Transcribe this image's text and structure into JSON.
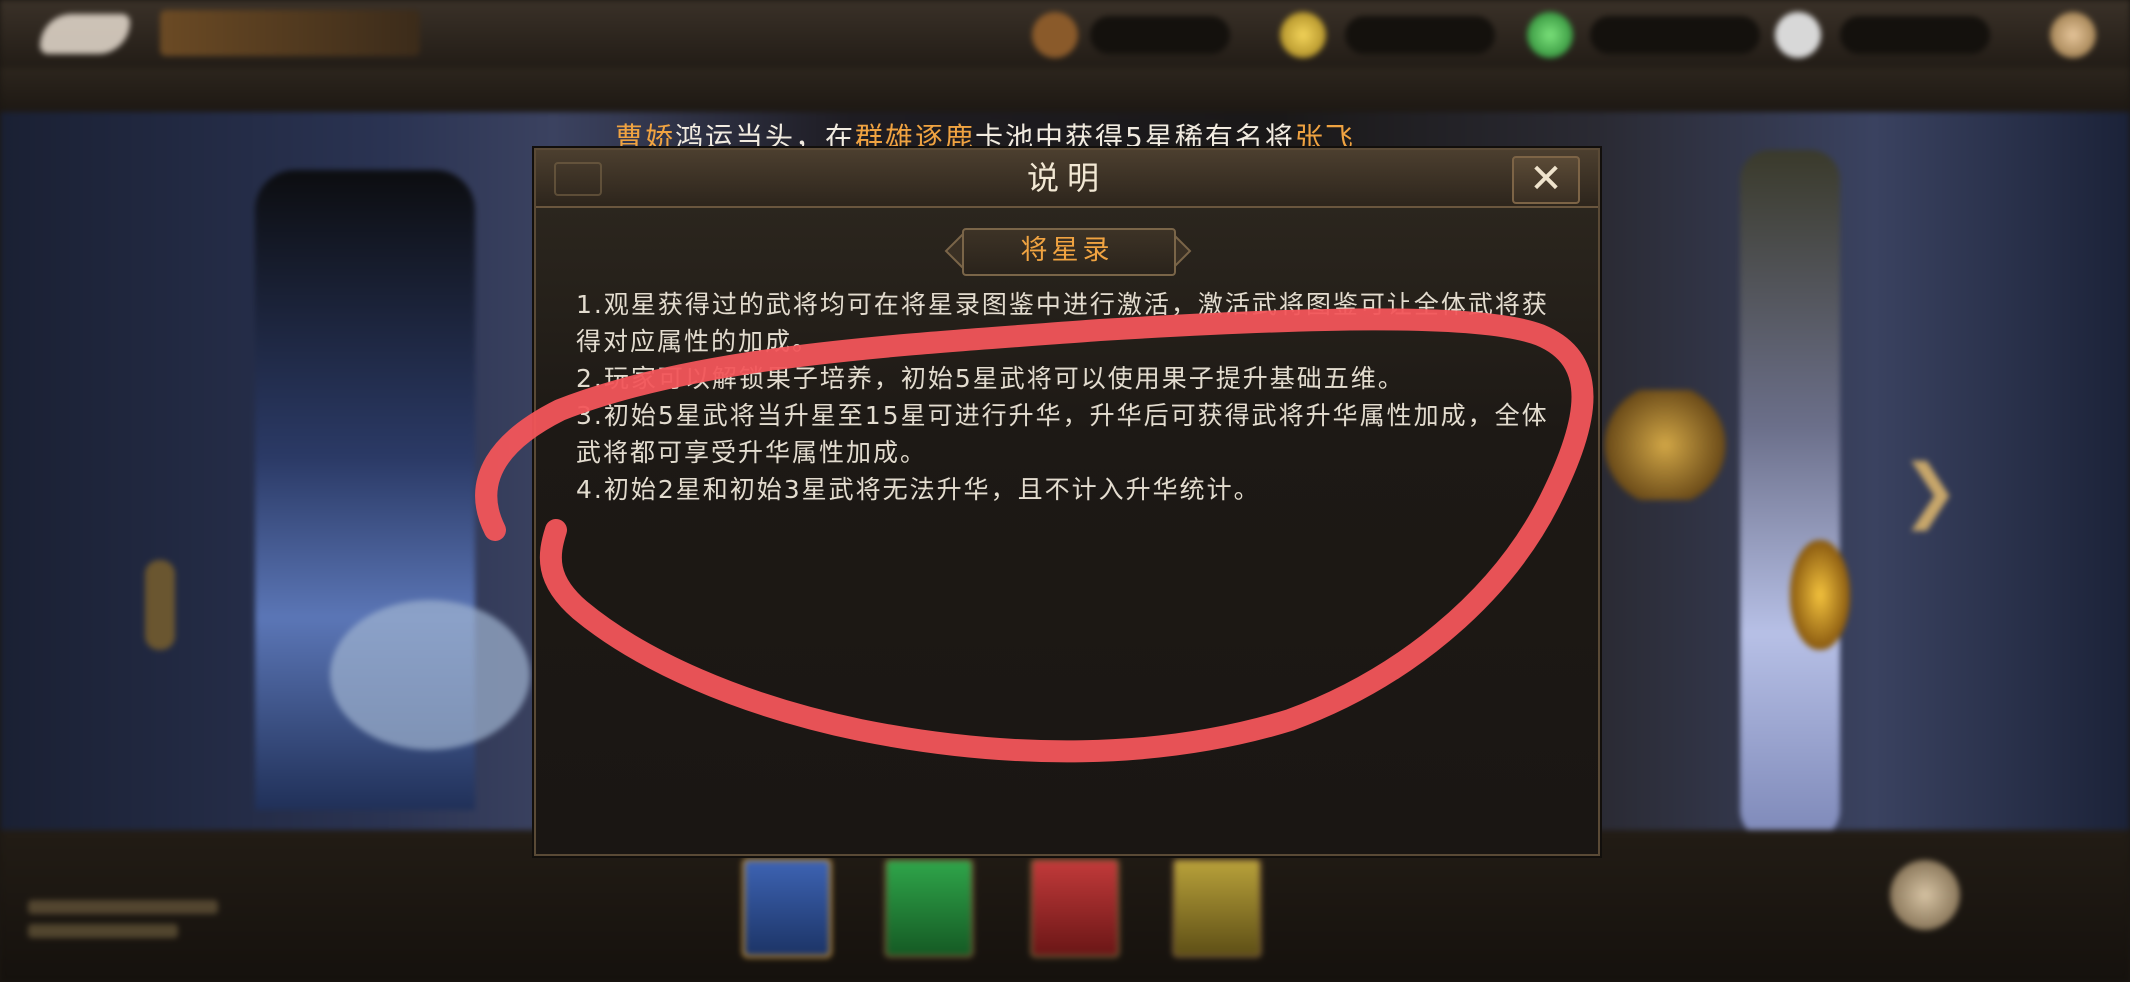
{
  "marquee": {
    "player": "曹娇",
    "text_1": "鸿运当头，在",
    "pool": "群雄逐鹿",
    "text_2": "卡池中获得5星稀有名将",
    "hero": "张飞"
  },
  "dialog": {
    "title": "说明",
    "close_icon": "close-x-icon",
    "subtitle": "将星录",
    "paragraphs": [
      "1.观星获得过的武将均可在将星录图鉴中进行激活，激活武将图鉴可让全体武将获得对应属性的加成。",
      "2.玩家可以解锁果子培养，初始5星武将可以使用果子提升基础五维。",
      "3.初始5星武将当升星至15星可进行升华，升华后可获得武将升华属性加成，全体武将都可享受升华属性加成。",
      "4.初始2星和初始3星武将无法升华，且不计入升华统计。"
    ]
  },
  "colors": {
    "highlight": "#f0a341",
    "body_text": "#e3dccf",
    "annotation_stroke": "#f2555a"
  }
}
